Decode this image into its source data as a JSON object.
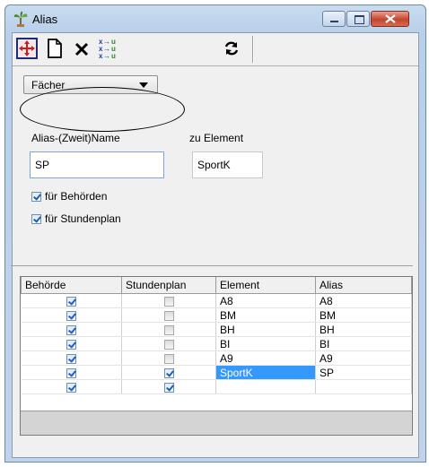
{
  "window": {
    "title": "Alias",
    "app_icon": "plant-icon"
  },
  "toolbar": {
    "buttons": [
      {
        "name": "move-arrows-icon"
      },
      {
        "name": "new-document-icon"
      },
      {
        "name": "delete-x-icon"
      },
      {
        "name": "assign-xu-icon"
      },
      {
        "name": "refresh-icon"
      }
    ]
  },
  "form": {
    "category_select": "Fächer",
    "alias_label": "Alias-(Zweit)Name",
    "alias_value": "SP",
    "element_label": "zu Element",
    "element_value": "SportK",
    "checkbox_behoerden": {
      "label": "für Behörden",
      "checked": true
    },
    "checkbox_stundenplan": {
      "label": "für Stundenplan",
      "checked": true
    }
  },
  "table": {
    "columns": [
      "Behörde",
      "Stundenplan",
      "Element",
      "Alias"
    ],
    "rows": [
      {
        "behoerde": true,
        "stundenplan": false,
        "element": "A8",
        "alias": "A8"
      },
      {
        "behoerde": true,
        "stundenplan": false,
        "element": "BM",
        "alias": "BM"
      },
      {
        "behoerde": true,
        "stundenplan": false,
        "element": "BH",
        "alias": "BH"
      },
      {
        "behoerde": true,
        "stundenplan": false,
        "element": "BI",
        "alias": "BI"
      },
      {
        "behoerde": true,
        "stundenplan": false,
        "element": "A9",
        "alias": "A9"
      },
      {
        "behoerde": true,
        "stundenplan": true,
        "element": "SportK",
        "alias": "SP",
        "selected": true
      },
      {
        "behoerde": true,
        "stundenplan": true,
        "element": "",
        "alias": ""
      }
    ]
  }
}
